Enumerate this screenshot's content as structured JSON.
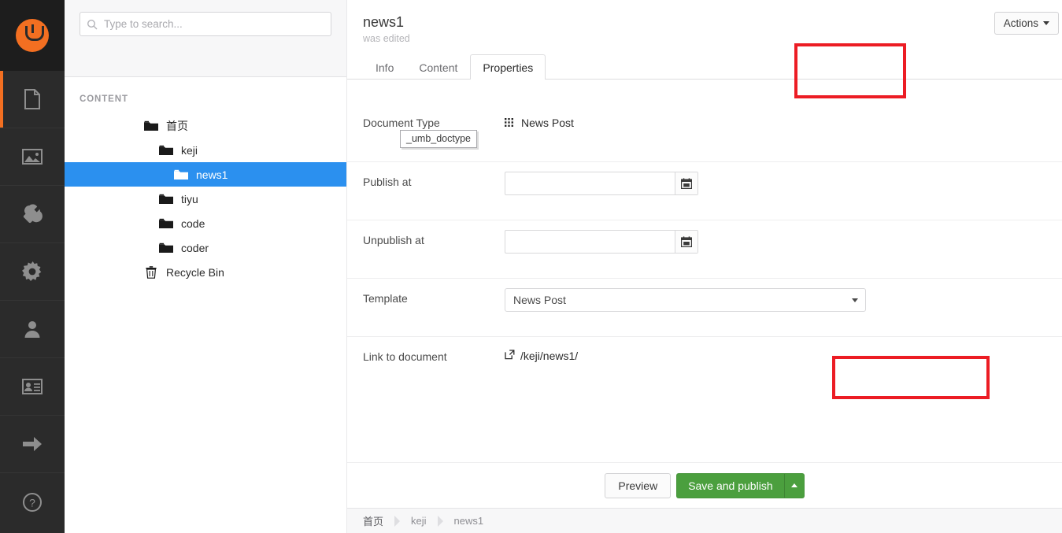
{
  "rail": {
    "logo_name": "umbraco-logo",
    "accent": "#f36f21",
    "items": [
      {
        "name": "content",
        "icon": "document-icon",
        "active": true
      },
      {
        "name": "media",
        "icon": "image-icon",
        "active": false
      },
      {
        "name": "settings",
        "icon": "wrench-icon",
        "active": false
      },
      {
        "name": "developer",
        "icon": "gear-icon",
        "active": false
      },
      {
        "name": "users",
        "icon": "user-icon",
        "active": false
      },
      {
        "name": "members",
        "icon": "member-card-icon",
        "active": false
      },
      {
        "name": "forms",
        "icon": "arrow-right-icon",
        "active": false
      },
      {
        "name": "help",
        "icon": "question-circle-icon",
        "active": false
      }
    ]
  },
  "tree": {
    "search": {
      "placeholder": "Type to search...",
      "value": "",
      "icon": "search-icon"
    },
    "section_title": "CONTENT",
    "nodes": [
      {
        "label": "首页",
        "depth": 0,
        "icon": "folder-icon",
        "selected": false
      },
      {
        "label": "keji",
        "depth": 1,
        "icon": "folder-icon",
        "selected": false
      },
      {
        "label": "news1",
        "depth": 2,
        "icon": "folder-icon",
        "selected": true
      },
      {
        "label": "tiyu",
        "depth": 1,
        "icon": "folder-icon",
        "selected": false
      },
      {
        "label": "code",
        "depth": 1,
        "icon": "folder-icon",
        "selected": false
      },
      {
        "label": "coder",
        "depth": 1,
        "icon": "folder-icon",
        "selected": false
      },
      {
        "label": "Recycle Bin",
        "depth": 0,
        "icon": "trash-icon",
        "selected": false
      }
    ],
    "selected_color": "#2b90ef"
  },
  "header": {
    "title": "news1",
    "actions_label": "Actions"
  },
  "tabs": {
    "items": [
      {
        "label": "Info",
        "active": false
      },
      {
        "label": "Content",
        "active": false
      },
      {
        "label": "Properties",
        "active": true
      }
    ],
    "edited_note": "was edited"
  },
  "properties": {
    "document_type": {
      "label": "Document Type",
      "value": "News Post",
      "icon": "grid-icon",
      "tooltip": "_umb_doctype"
    },
    "publish_at": {
      "label": "Publish at",
      "value": "",
      "placeholder": "",
      "icon": "calendar-icon"
    },
    "unpublish_at": {
      "label": "Unpublish at",
      "value": "",
      "placeholder": "",
      "icon": "calendar-icon"
    },
    "template": {
      "label": "Template",
      "value": "News Post",
      "icon": "chevron-down-icon"
    },
    "link_to_document": {
      "label": "Link to document",
      "value": "/keji/news1/",
      "icon": "external-link-icon"
    }
  },
  "footer": {
    "preview_label": "Preview",
    "publish_label": "Save and publish",
    "publish_color": "#4b9f3e"
  },
  "breadcrumb": {
    "items": [
      "首页",
      "keji",
      "news1"
    ]
  },
  "annotations": {
    "color": "#ec1c24",
    "boxes": [
      {
        "name": "properties-tab-highlight"
      },
      {
        "name": "link-to-document-highlight"
      }
    ]
  }
}
